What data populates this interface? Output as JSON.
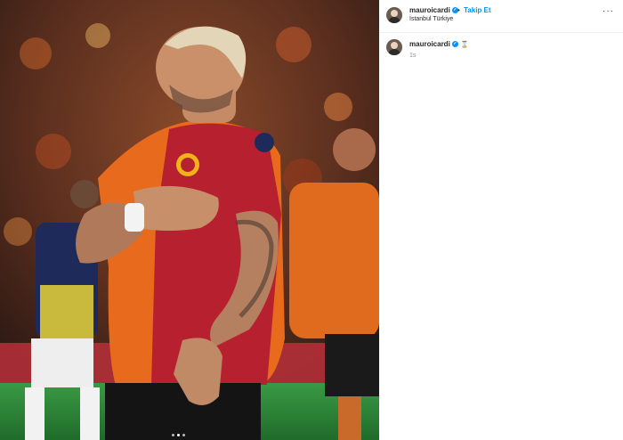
{
  "post": {
    "username": "mauroicardi",
    "follow_label": "Takip Et",
    "location": "İstanbul Türkiye",
    "more_icon": "more-horizontal-icon",
    "verified_icon": "verified-badge-icon",
    "caption_emoji": "⌛",
    "time_ago": "1s",
    "carousel_total": 3,
    "carousel_active": 2
  },
  "colors": {
    "accent": "#0095f6",
    "jersey_red": "#b7202e",
    "jersey_orange": "#e86a1c",
    "pitch_green": "#2e8b3a"
  }
}
